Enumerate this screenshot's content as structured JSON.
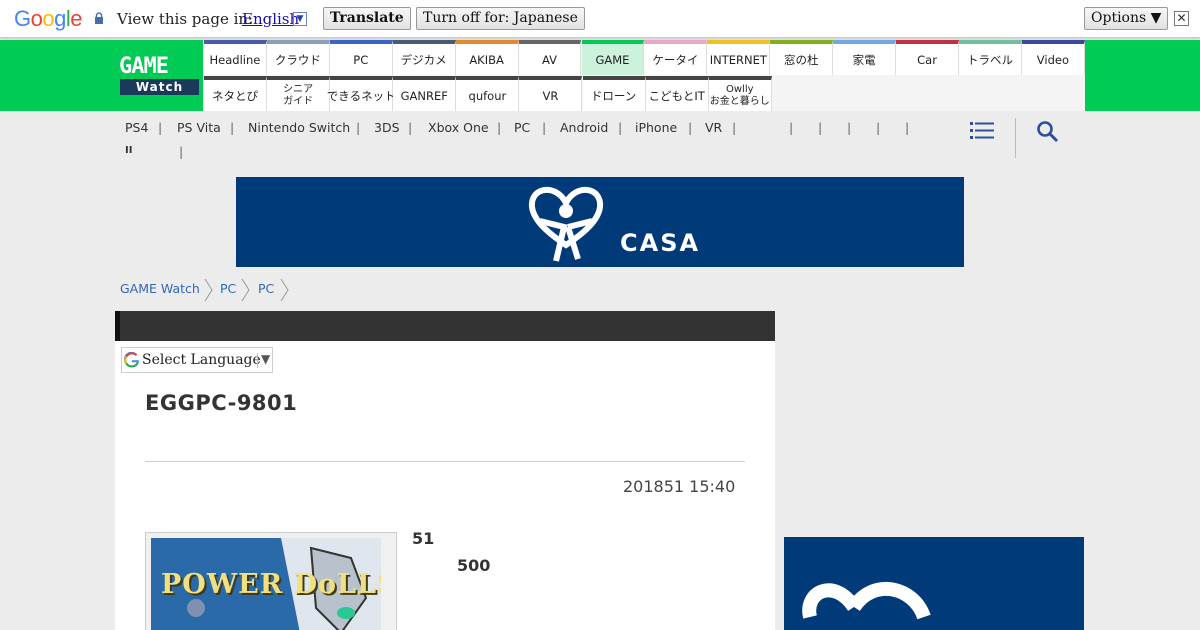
{
  "translate_bar": {
    "logo_letters": [
      {
        "ch": "G",
        "color": "#4285f4"
      },
      {
        "ch": "o",
        "color": "#ea4335"
      },
      {
        "ch": "o",
        "color": "#fbbc05"
      },
      {
        "ch": "g",
        "color": "#4285f4"
      },
      {
        "ch": "l",
        "color": "#34a853"
      },
      {
        "ch": "e",
        "color": "#ea4335"
      }
    ],
    "view_text": "View this page in:",
    "language": "English",
    "translate_label": "Translate",
    "turn_off_label": "Turn off for: Japanese",
    "options_label": "Options ▼",
    "close_glyph": "✕"
  },
  "header": {
    "logo_game": "GAME",
    "logo_watch": "Watch",
    "nav_row1": [
      {
        "label": "Headline",
        "color": "#4a5aa8"
      },
      {
        "label": "クラウド",
        "color": "#8aa0b8"
      },
      {
        "label": "PC",
        "color": "#3a64c8"
      },
      {
        "label": "デジカメ",
        "color": "#4a5a70"
      },
      {
        "label": "AKIBA",
        "color": "#e08a30"
      },
      {
        "label": "AV",
        "color": "#666666"
      },
      {
        "label": "GAME",
        "color": "#00cc55",
        "active": true
      },
      {
        "label": "ケータイ",
        "color": "#e8a8c8"
      },
      {
        "label": "INTERNET",
        "color": "#f0c020"
      },
      {
        "label": "窓の杜",
        "color": "#80b020"
      },
      {
        "label": "家電",
        "color": "#70a8e0"
      },
      {
        "label": "Car",
        "color": "#c03040"
      },
      {
        "label": "トラベル",
        "color": "#70c0a0"
      },
      {
        "label": "Video",
        "color": "#3a4aa0"
      }
    ],
    "nav_row2": [
      {
        "label": "ネタとぴ",
        "color": "#444444"
      },
      {
        "label": "シニア\nガイド",
        "color": "#444444"
      },
      {
        "label": "できるネット",
        "color": "#444444"
      },
      {
        "label": "GANREF",
        "color": "#444444"
      },
      {
        "label": "qufour",
        "color": "#444444"
      },
      {
        "label": "VR",
        "color": "#444444"
      },
      {
        "label": "ドローン",
        "color": "#444444"
      },
      {
        "label": "こどもとIT",
        "color": "#444444"
      },
      {
        "label": "Owlly\nお金と暮らし",
        "color": "#444444"
      }
    ]
  },
  "subnav": {
    "items": [
      "PS4",
      "PS Vita",
      "Nintendo Switch",
      "3DS",
      "Xbox One",
      "PC",
      "Android",
      "iPhone",
      "VR"
    ],
    "pause_glyph": "II"
  },
  "banner": {
    "brand": "CASA"
  },
  "breadcrumb": [
    "GAME Watch",
    "PC",
    "PC"
  ],
  "article": {
    "select_language": "Select Language",
    "title": "EGGPC-9801",
    "date": "201851 15:40",
    "snippet1": "51",
    "snippet2": "500",
    "thumb_text": "POWER DoLLS"
  }
}
